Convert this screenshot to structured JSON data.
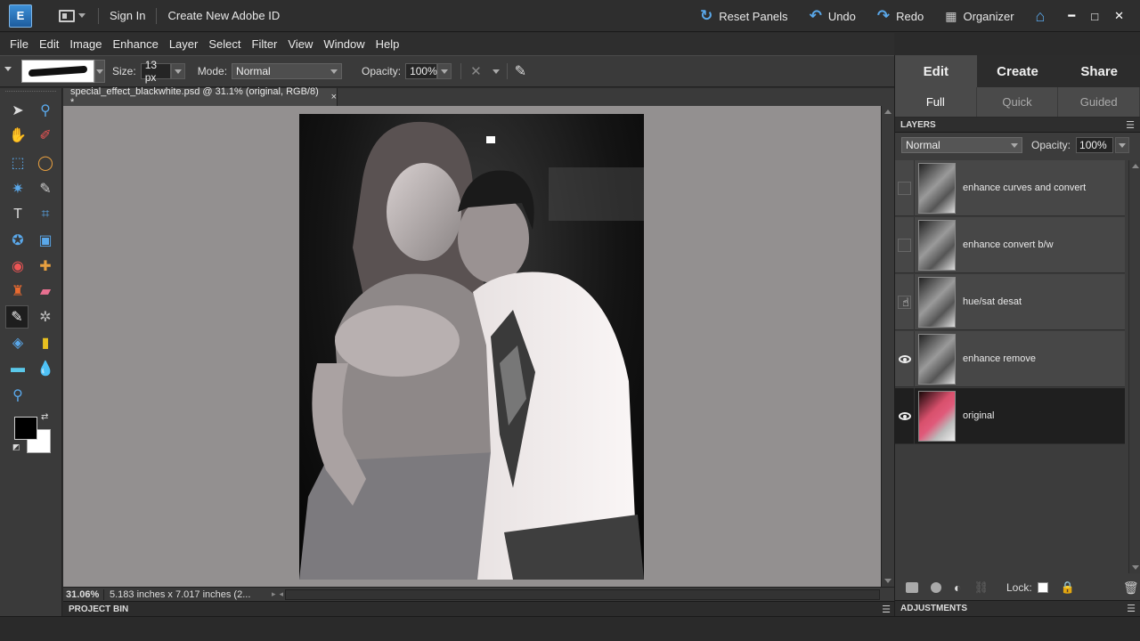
{
  "topbar": {
    "sign_in": "Sign In",
    "create_id": "Create New Adobe ID",
    "reset_panels": "Reset Panels",
    "undo": "Undo",
    "redo": "Redo",
    "organizer": "Organizer",
    "logo_letter": "E"
  },
  "menu": [
    "File",
    "Edit",
    "Image",
    "Enhance",
    "Layer",
    "Select",
    "Filter",
    "View",
    "Window",
    "Help"
  ],
  "options": {
    "size_label": "Size:",
    "size_value": "13 px",
    "mode_label": "Mode:",
    "mode_value": "Normal",
    "opacity_label": "Opacity:",
    "opacity_value": "100%"
  },
  "document": {
    "tab_title": "special_effect_blackwhite.psd @ 31.1% (original, RGB/8) *",
    "close_glyph": "×"
  },
  "status": {
    "zoom": "31.06%",
    "doc_size": "5.183 inches x 7.017 inches (2..."
  },
  "bins": {
    "project_bin": "PROJECT BIN",
    "adjustments": "ADJUSTMENTS"
  },
  "right_panel": {
    "tabs": [
      "Edit",
      "Create",
      "Share"
    ],
    "subtabs": [
      "Full",
      "Quick",
      "Guided"
    ],
    "layers_title": "LAYERS",
    "blend_mode": "Normal",
    "opacity_label": "Opacity:",
    "opacity_value": "100%",
    "lock_label": "Lock:"
  },
  "layers": [
    {
      "name": "enhance curves and convert",
      "visible": false,
      "selected": false,
      "color": false
    },
    {
      "name": "enhance convert b/w",
      "visible": false,
      "selected": false,
      "color": false
    },
    {
      "name": "hue/sat desat",
      "visible": false,
      "selected": false,
      "color": false
    },
    {
      "name": "enhance remove",
      "visible": true,
      "selected": false,
      "color": false
    },
    {
      "name": "original",
      "visible": true,
      "selected": true,
      "color": true
    }
  ],
  "colors": {
    "foreground": "#000000",
    "background": "#ffffff",
    "canvas_bg": "#939090",
    "accent_blue": "#5aa8ea"
  }
}
